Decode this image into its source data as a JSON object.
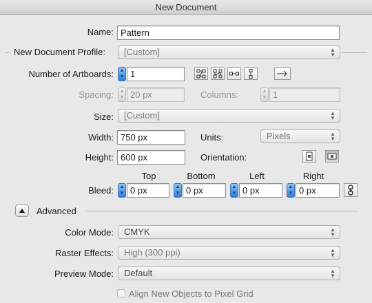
{
  "window": {
    "title": "New Document"
  },
  "name": {
    "label": "Name:",
    "value": "Pattern"
  },
  "profile": {
    "label": "New Document Profile:",
    "value": "[Custom]"
  },
  "artboards": {
    "label": "Number of Artboards:",
    "value": "1",
    "icons": [
      "grid-by-row-icon",
      "grid-by-column-icon",
      "arrange-by-row-icon",
      "arrange-by-column-icon",
      "left-to-right-icon"
    ]
  },
  "spacing": {
    "label": "Spacing:",
    "value": "20 px"
  },
  "columns": {
    "label": "Columns:",
    "value": "1"
  },
  "size": {
    "label": "Size:",
    "value": "[Custom]"
  },
  "width": {
    "label": "Width:",
    "value": "750 px"
  },
  "units": {
    "label": "Units:",
    "value": "Pixels"
  },
  "height": {
    "label": "Height:",
    "value": "600 px"
  },
  "orientation": {
    "label": "Orientation:"
  },
  "bleed": {
    "label": "Bleed:",
    "top": {
      "label": "Top",
      "value": "0 px"
    },
    "bottom": {
      "label": "Bottom",
      "value": "0 px"
    },
    "left": {
      "label": "Left",
      "value": "0 px"
    },
    "right": {
      "label": "Right",
      "value": "0 px"
    }
  },
  "advanced": {
    "label": "Advanced",
    "color_mode": {
      "label": "Color Mode:",
      "value": "CMYK"
    },
    "raster_effects": {
      "label": "Raster Effects:",
      "value": "High (300 ppi)"
    },
    "preview_mode": {
      "label": "Preview Mode:",
      "value": "Default"
    },
    "align_pixel_grid": {
      "label": "Align New Objects to Pixel Grid",
      "checked": false
    }
  },
  "colors": {
    "accent": "#3a87db",
    "background": "#e8e8e8"
  }
}
